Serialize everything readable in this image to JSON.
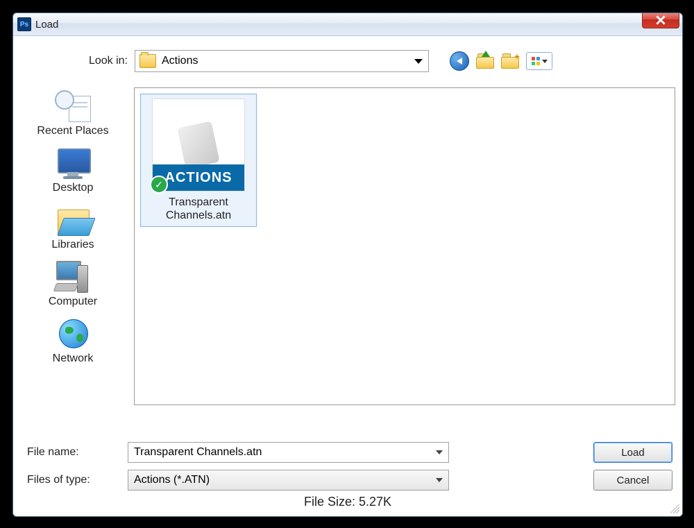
{
  "window": {
    "title": "Load"
  },
  "lookin": {
    "label": "Look in:",
    "value": "Actions"
  },
  "places": [
    {
      "id": "recent",
      "label": "Recent Places"
    },
    {
      "id": "desktop",
      "label": "Desktop"
    },
    {
      "id": "libraries",
      "label": "Libraries"
    },
    {
      "id": "computer",
      "label": "Computer"
    },
    {
      "id": "network",
      "label": "Network"
    }
  ],
  "files": [
    {
      "name": "Transparent Channels.atn",
      "badge": "ACTIONS",
      "selected": true
    }
  ],
  "file_name": {
    "label": "File name:",
    "value": "Transparent Channels.atn"
  },
  "file_type": {
    "label": "Files of type:",
    "value": "Actions (*.ATN)"
  },
  "buttons": {
    "load": "Load",
    "cancel": "Cancel"
  },
  "file_size_label": "File Size: 5.27K"
}
